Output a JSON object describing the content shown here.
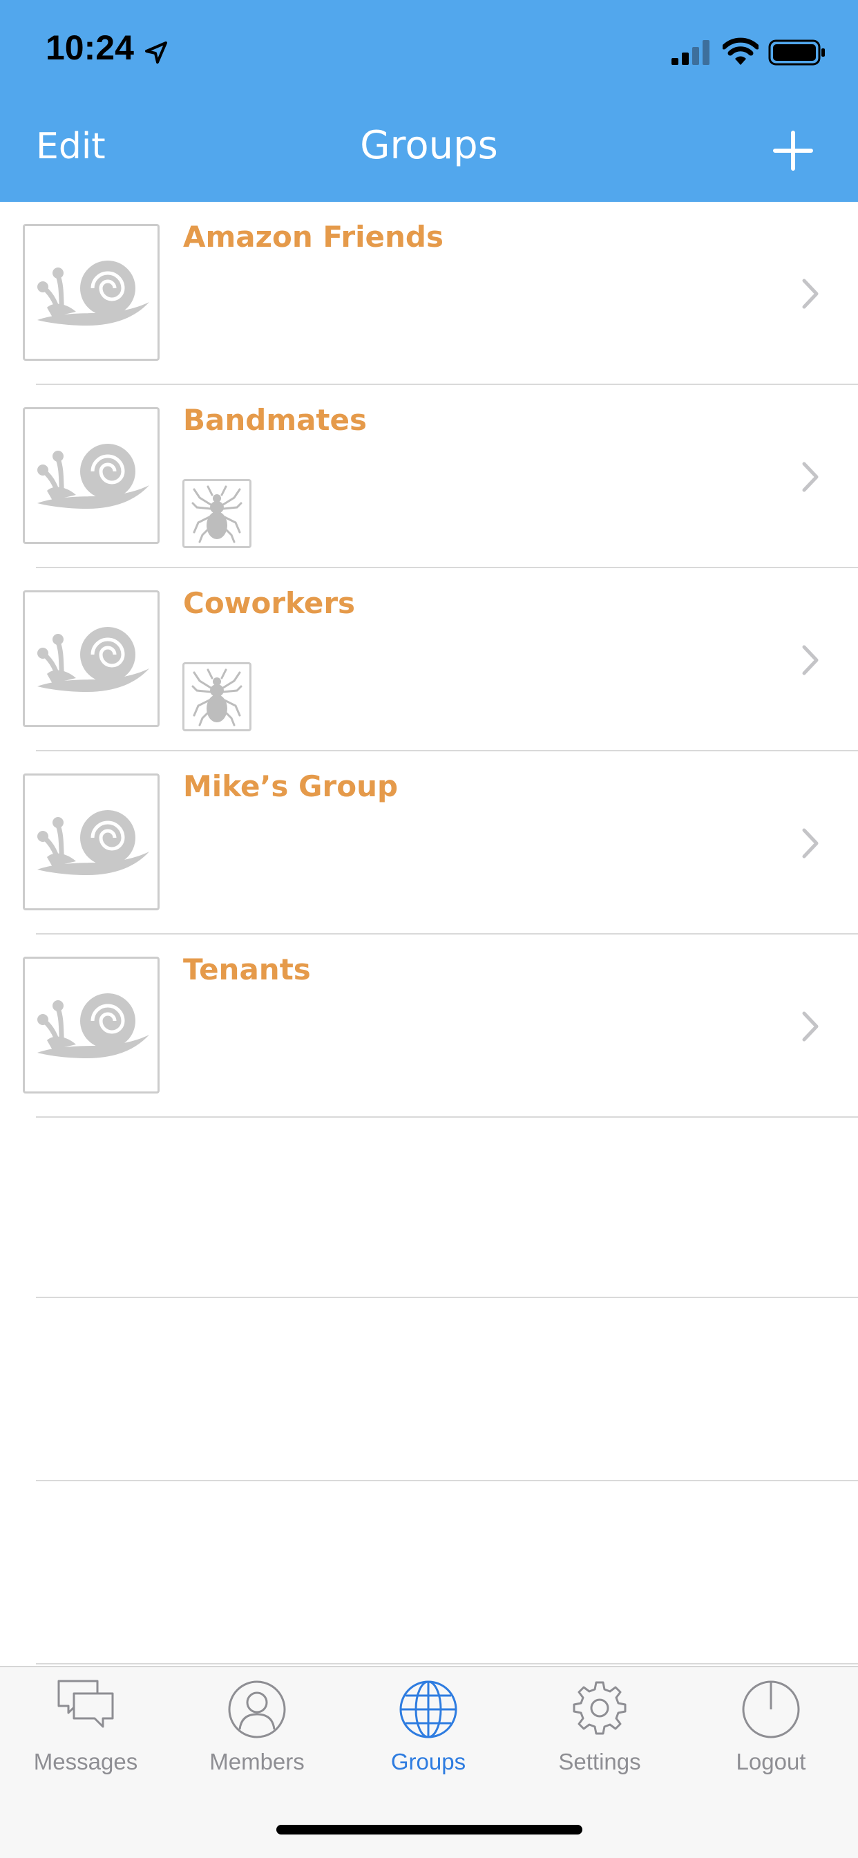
{
  "status_bar": {
    "time": "10:24"
  },
  "nav": {
    "edit_label": "Edit",
    "title": "Groups"
  },
  "groups": [
    {
      "name": "Amazon Friends",
      "has_member_thumb": false
    },
    {
      "name": "Bandmates",
      "has_member_thumb": true
    },
    {
      "name": "Coworkers",
      "has_member_thumb": true
    },
    {
      "name": "Mike’s Group",
      "has_member_thumb": false
    },
    {
      "name": "Tenants",
      "has_member_thumb": false
    }
  ],
  "tabs": [
    {
      "label": "Messages",
      "icon": "messages-icon",
      "active": false
    },
    {
      "label": "Members",
      "icon": "members-icon",
      "active": false
    },
    {
      "label": "Groups",
      "icon": "globe-icon",
      "active": true
    },
    {
      "label": "Settings",
      "icon": "gear-icon",
      "active": false
    },
    {
      "label": "Logout",
      "icon": "power-icon",
      "active": false
    }
  ],
  "colors": {
    "header": "#52A7ED",
    "group_name": "#E59A4A",
    "tab_active": "#2E7CE0",
    "tab_inactive": "#8E8E93"
  }
}
